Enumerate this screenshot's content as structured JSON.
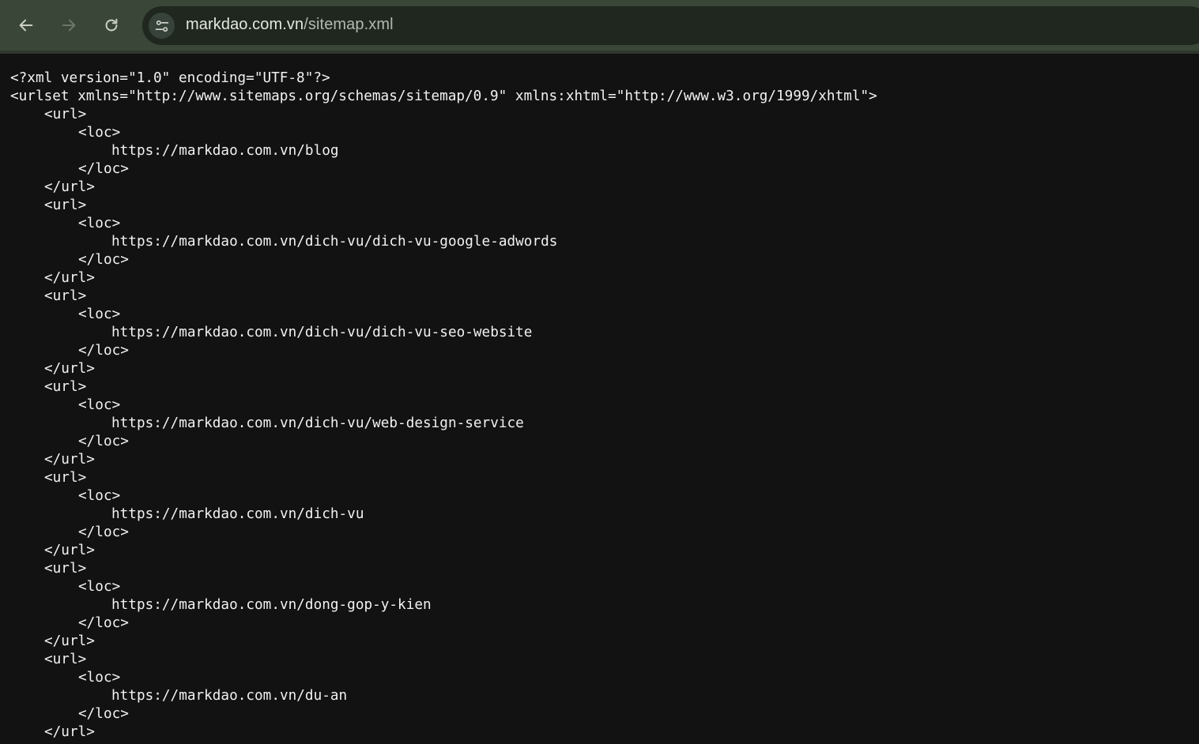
{
  "toolbar": {
    "back_icon": "arrow-left-icon",
    "forward_icon": "arrow-right-icon",
    "reload_icon": "reload-icon",
    "site_info_icon": "tune-icon"
  },
  "address_bar": {
    "host": "markdao.com.vn",
    "path": "/sitemap.xml"
  },
  "xml": {
    "declaration": "<?xml version=\"1.0\" encoding=\"UTF-8\"?>",
    "urlset_open": "<urlset xmlns=\"http://www.sitemaps.org/schemas/sitemap/0.9\" xmlns:xhtml=\"http://www.w3.org/1999/xhtml\">",
    "url_open": "<url>",
    "url_close": "</url>",
    "loc_open": "<loc>",
    "loc_close": "</loc>",
    "urls": [
      "https://markdao.com.vn/blog",
      "https://markdao.com.vn/dich-vu/dich-vu-google-adwords",
      "https://markdao.com.vn/dich-vu/dich-vu-seo-website",
      "https://markdao.com.vn/dich-vu/web-design-service",
      "https://markdao.com.vn/dich-vu",
      "https://markdao.com.vn/dong-gop-y-kien",
      "https://markdao.com.vn/du-an"
    ]
  }
}
